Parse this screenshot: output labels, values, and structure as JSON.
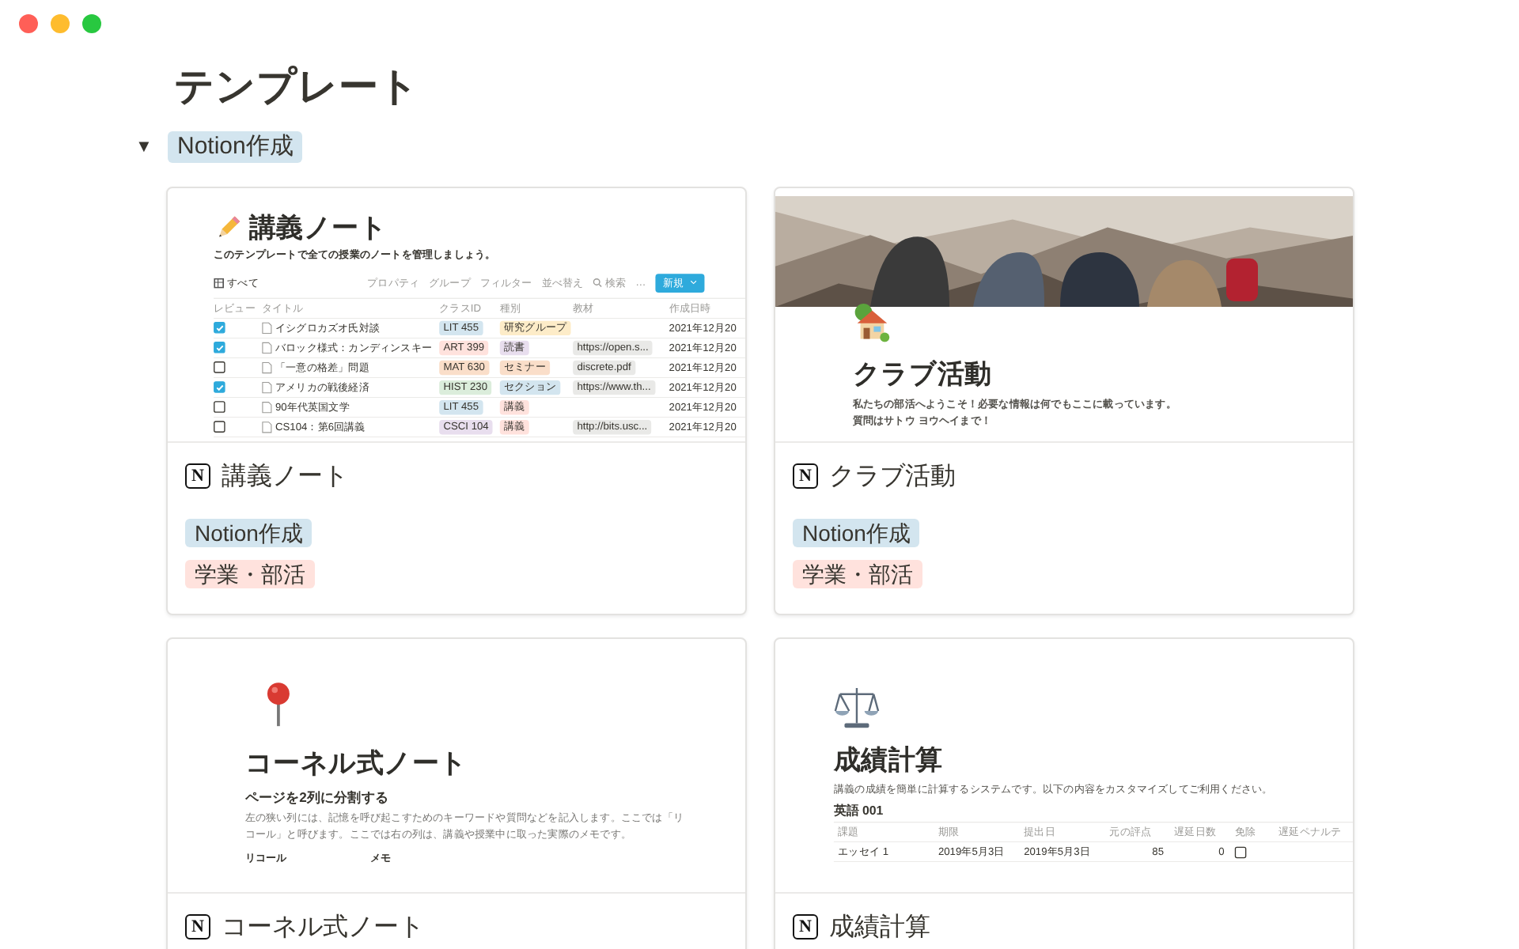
{
  "page_title": "テンプレート",
  "group": {
    "toggle": "▼",
    "expanded": true,
    "tag": {
      "label": "Notion作成",
      "color": "#d3e5ef"
    }
  },
  "cards": [
    {
      "kind": "database",
      "logo": "N",
      "title": "講義ノート",
      "tags": [
        {
          "label": "Notion作成",
          "color": "#d3e5ef"
        },
        {
          "label": "学業・部活",
          "color": "#ffe2dd"
        }
      ],
      "preview": {
        "title": "講義ノート",
        "subtitle": "このテンプレートで全ての授業のノートを管理しましょう。",
        "view": "すべて",
        "actions": [
          "プロパティ",
          "グループ",
          "フィルター",
          "並べ替え",
          "検索",
          "…"
        ],
        "new_button": "新規",
        "columns": [
          "レビュー",
          "タイトル",
          "クラスID",
          "種別",
          "教材",
          "作成日時"
        ],
        "rows": [
          {
            "checked": true,
            "title": "イシグロカズオ氏対談",
            "class_id": {
              "label": "LIT 455",
              "color": "#d3e5ef"
            },
            "type": {
              "label": "研究グループ",
              "color": "#fdecc8"
            },
            "material": "",
            "created": "2021年12月20"
          },
          {
            "checked": true,
            "title": "バロック様式：カンディンスキー",
            "class_id": {
              "label": "ART 399",
              "color": "#ffe2dd"
            },
            "type": {
              "label": "読書",
              "color": "#e8deee"
            },
            "material": "https://open.s...",
            "created": "2021年12月20"
          },
          {
            "checked": false,
            "title": "「一意の格差」問題",
            "class_id": {
              "label": "MAT 630",
              "color": "#fadec9"
            },
            "type": {
              "label": "セミナー",
              "color": "#fadec9"
            },
            "material": "discrete.pdf",
            "created": "2021年12月20"
          },
          {
            "checked": true,
            "title": "アメリカの戦後経済",
            "class_id": {
              "label": "HIST 230",
              "color": "#dbeddb"
            },
            "type": {
              "label": "セクション",
              "color": "#d3e5ef"
            },
            "material": "https://www.th...",
            "created": "2021年12月20"
          },
          {
            "checked": false,
            "title": "90年代英国文学",
            "class_id": {
              "label": "LIT 455",
              "color": "#d3e5ef"
            },
            "type": {
              "label": "講義",
              "color": "#ffe2dd"
            },
            "material": "",
            "created": "2021年12月20"
          },
          {
            "checked": false,
            "title": "CS104：第6回講義",
            "class_id": {
              "label": "CSCI 104",
              "color": "#e8deee"
            },
            "type": {
              "label": "講義",
              "color": "#ffe2dd"
            },
            "material": "http://bits.usc...",
            "created": "2021年12月20"
          }
        ]
      }
    },
    {
      "kind": "cover",
      "logo": "N",
      "title": "クラブ活動",
      "tags": [
        {
          "label": "Notion作成",
          "color": "#d3e5ef"
        },
        {
          "label": "学業・部活",
          "color": "#ffe2dd"
        }
      ],
      "preview": {
        "title": "クラブ活動",
        "description": [
          "私たちの部活へようこそ！必要な情報は何でもここに載っています。",
          "質問はサトウ ヨウヘイまで！"
        ]
      }
    },
    {
      "kind": "notes",
      "logo": "N",
      "title": "コーネル式ノート",
      "preview": {
        "title": "コーネル式ノート",
        "heading": "ページを2列に分割する",
        "paragraph": "左の狭い列には、記憶を呼び起こすためのキーワードや質問などを記入します。ここでは「リコール」と呼びます。ここでは右の列は、講義や授業中に取った実際のメモです。",
        "columns": [
          "リコール",
          "メモ"
        ]
      }
    },
    {
      "kind": "grades",
      "logo": "N",
      "title": "成績計算",
      "preview": {
        "title": "成績計算",
        "description": "講義の成績を簡単に計算するシステムです。以下の内容をカスタマイズしてご利用ください。",
        "subheading": "英語 001",
        "columns": [
          "課題",
          "期限",
          "提出日",
          "元の評点",
          "遅延日数",
          "免除",
          "遅延ペナルテ"
        ],
        "rows": [
          {
            "cells": [
              "エッセイ 1",
              "2019年5月3日",
              "2019年5月3日",
              "85",
              "0"
            ],
            "exempt": false
          }
        ]
      }
    }
  ]
}
